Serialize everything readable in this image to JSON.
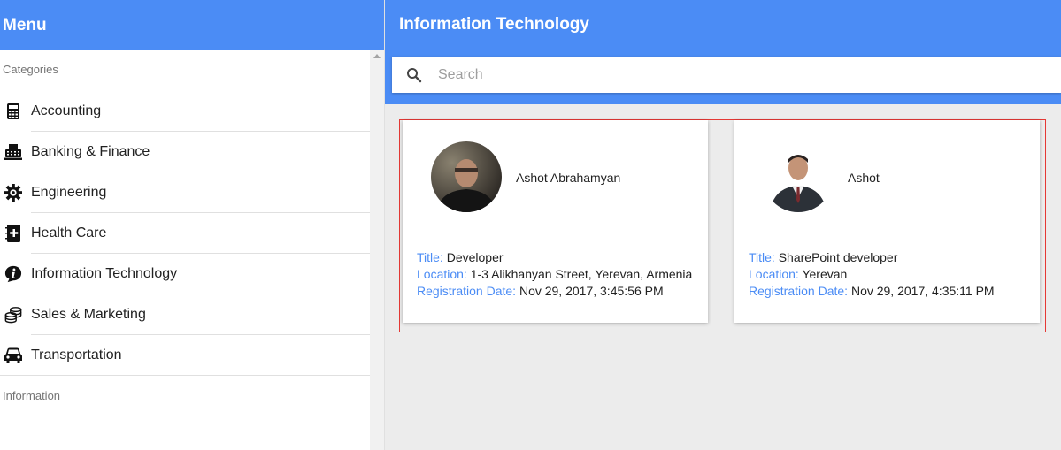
{
  "sidebar": {
    "title": "Menu",
    "categories_header": "Categories",
    "items": [
      {
        "label": "Accounting",
        "icon": "calculator-icon"
      },
      {
        "label": "Banking & Finance",
        "icon": "cash-register-icon"
      },
      {
        "label": "Engineering",
        "icon": "gear-icon"
      },
      {
        "label": "Health Care",
        "icon": "medical-book-icon"
      },
      {
        "label": "Information Technology",
        "icon": "info-icon"
      },
      {
        "label": "Sales & Marketing",
        "icon": "coins-icon"
      },
      {
        "label": "Transportation",
        "icon": "car-icon"
      }
    ],
    "information_header": "Information"
  },
  "main": {
    "title": "Information Technology",
    "search": {
      "placeholder": "Search",
      "value": ""
    },
    "cards": [
      {
        "name": "Ashot Abrahamyan",
        "title_label": "Title:",
        "title": "Developer",
        "location_label": "Location:",
        "location": "1-3 Alikhanyan Street, Yerevan, Armenia",
        "date_label": "Registration Date:",
        "date": "Nov 29, 2017, 3:45:56 PM"
      },
      {
        "name": "Ashot",
        "title_label": "Title:",
        "title": "SharePoint developer",
        "location_label": "Location:",
        "location": "Yerevan",
        "date_label": "Registration Date:",
        "date": "Nov 29, 2017, 4:35:11 PM"
      }
    ]
  },
  "colors": {
    "accent": "#4b8cf5",
    "background": "#ececec",
    "highlight_border": "#e53935"
  }
}
